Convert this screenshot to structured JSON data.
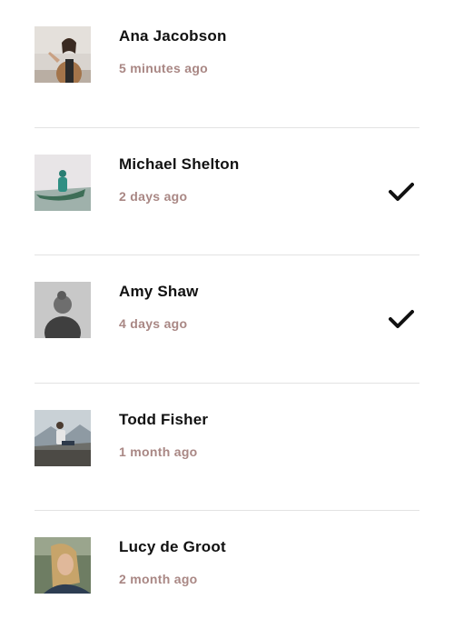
{
  "items": [
    {
      "name": "Ana Jacobson",
      "time": "5 minutes ago",
      "checked": false,
      "avatar": "photo-woman-pointing"
    },
    {
      "name": "Michael Shelton",
      "time": "2 days ago",
      "checked": true,
      "avatar": "photo-canoe-lake"
    },
    {
      "name": "Amy Shaw",
      "time": "4 days ago",
      "checked": true,
      "avatar": "photo-woman-back-grayscale"
    },
    {
      "name": "Todd Fisher",
      "time": "1 month ago",
      "checked": false,
      "avatar": "photo-man-sitting-mountains"
    },
    {
      "name": "Lucy de Groot",
      "time": "2 month ago",
      "checked": false,
      "avatar": "photo-woman-blonde-portrait"
    }
  ],
  "colors": {
    "name": "#111111",
    "time": "#a98784",
    "divider": "#e3e3e3",
    "check": "#111111"
  }
}
